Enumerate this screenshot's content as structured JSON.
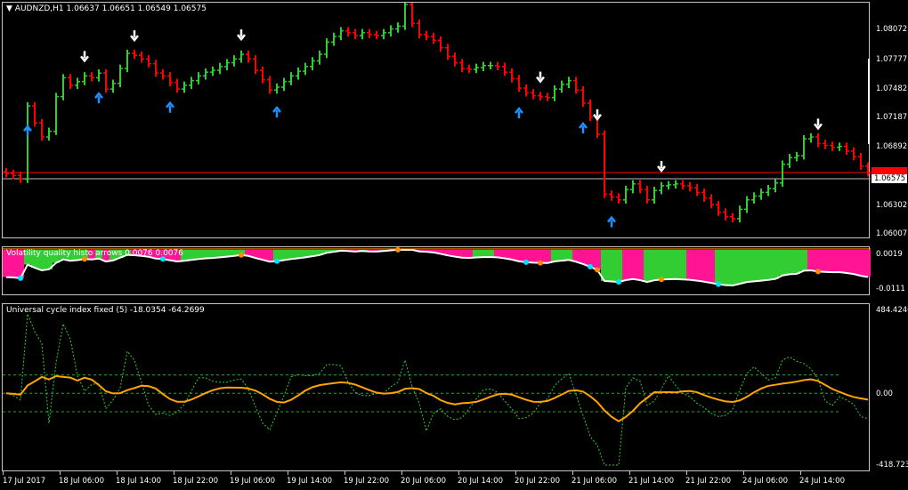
{
  "main_chart": {
    "title": "AUDNZD,H1  1.06637 1.06651 1.06549 1.06575",
    "price_labels": [
      "1.08072",
      "1.07777",
      "1.07482",
      "1.07187",
      "1.06892",
      "1.06302",
      "1.06007"
    ],
    "current_price_label": "1.06575",
    "red_line_label": "1.06631",
    "colors": {
      "bull": "#32cd32",
      "bear": "#ff0000",
      "arrow_up": "#1e90ff",
      "arrow_down": "#ffffff",
      "grid_line": "#ff0000"
    }
  },
  "volatility_panel": {
    "title": "Volatility quality histo arrows  0.0076  0.0076",
    "scale_top": "0.0019",
    "scale_bottom": "-0.0111",
    "colors": {
      "green": "#32cd32",
      "pink": "#ff1493",
      "line": "#ffffff"
    }
  },
  "uci_panel": {
    "title": "Universal cycle index fixed (5)  -18.0354  -64.2699",
    "scale_top": "484.4246",
    "scale_mid": "0.00",
    "scale_bottom": "-418.7231",
    "colors": {
      "orange": "#ffa500",
      "green_dash": "#32cd32",
      "level": "#32cd32"
    }
  },
  "time_labels": [
    "17 Jul 2017",
    "18 Jul 06:00",
    "18 Jul 14:00",
    "18 Jul 22:00",
    "19 Jul 06:00",
    "19 Jul 14:00",
    "19 Jul 22:00",
    "20 Jul 06:00",
    "20 Jul 14:00",
    "20 Jul 22:00",
    "21 Jul 06:00",
    "21 Jul 14:00",
    "21 Jul 22:00",
    "24 Jul 06:00",
    "24 Jul 14:00"
  ],
  "chart_data": [
    {
      "type": "ohlc",
      "symbol": "AUDNZD",
      "timeframe": "H1",
      "ylim": [
        1.059,
        1.084
      ],
      "closes": [
        1.0658,
        1.0656,
        1.0652,
        1.073,
        1.0712,
        1.0697,
        1.0703,
        1.074,
        1.076,
        1.0752,
        1.0756,
        1.0762,
        1.076,
        1.0765,
        1.0748,
        1.0754,
        1.077,
        1.0786,
        1.0784,
        1.078,
        1.0775,
        1.0765,
        1.0762,
        1.0755,
        1.0748,
        1.0752,
        1.0757,
        1.0762,
        1.0766,
        1.0768,
        1.0772,
        1.0776,
        1.078,
        1.0785,
        1.078,
        1.0768,
        1.0758,
        1.0747,
        1.075,
        1.0756,
        1.0762,
        1.0767,
        1.0772,
        1.0778,
        1.0785,
        1.0798,
        1.0804,
        1.081,
        1.0808,
        1.0805,
        1.0808,
        1.0806,
        1.0805,
        1.0808,
        1.0812,
        1.0815,
        1.0838,
        1.0818,
        1.0806,
        1.0804,
        1.08,
        1.0792,
        1.0783,
        1.0776,
        1.077,
        1.0769,
        1.0771,
        1.0773,
        1.0773,
        1.0772,
        1.0766,
        1.0759,
        1.0749,
        1.0744,
        1.0741,
        1.074,
        1.0739,
        1.0748,
        1.0753,
        1.0757,
        1.0747,
        1.0733,
        1.0718,
        1.07,
        1.0636,
        1.0633,
        1.063,
        1.0641,
        1.0647,
        1.0641,
        1.063,
        1.064,
        1.0645,
        1.0646,
        1.0647,
        1.0645,
        1.0643,
        1.0638,
        1.0632,
        1.0625,
        1.0617,
        1.0612,
        1.061,
        1.062,
        1.063,
        1.0634,
        1.0638,
        1.0642,
        1.0648,
        1.0668,
        1.0675,
        1.0677,
        1.0695,
        1.0697,
        1.069,
        1.0688,
        1.0686,
        1.0687,
        1.0682,
        1.0676,
        1.0666,
        1.0659
      ]
    },
    {
      "type": "histogram",
      "name": "Volatility quality histo arrows",
      "ylim": [
        -0.0111,
        0.0019
      ]
    },
    {
      "type": "line",
      "name": "Universal cycle index fixed (5)",
      "ylim": [
        -418.7231,
        484.4246
      ],
      "levels": [
        100,
        0,
        -100
      ]
    }
  ]
}
